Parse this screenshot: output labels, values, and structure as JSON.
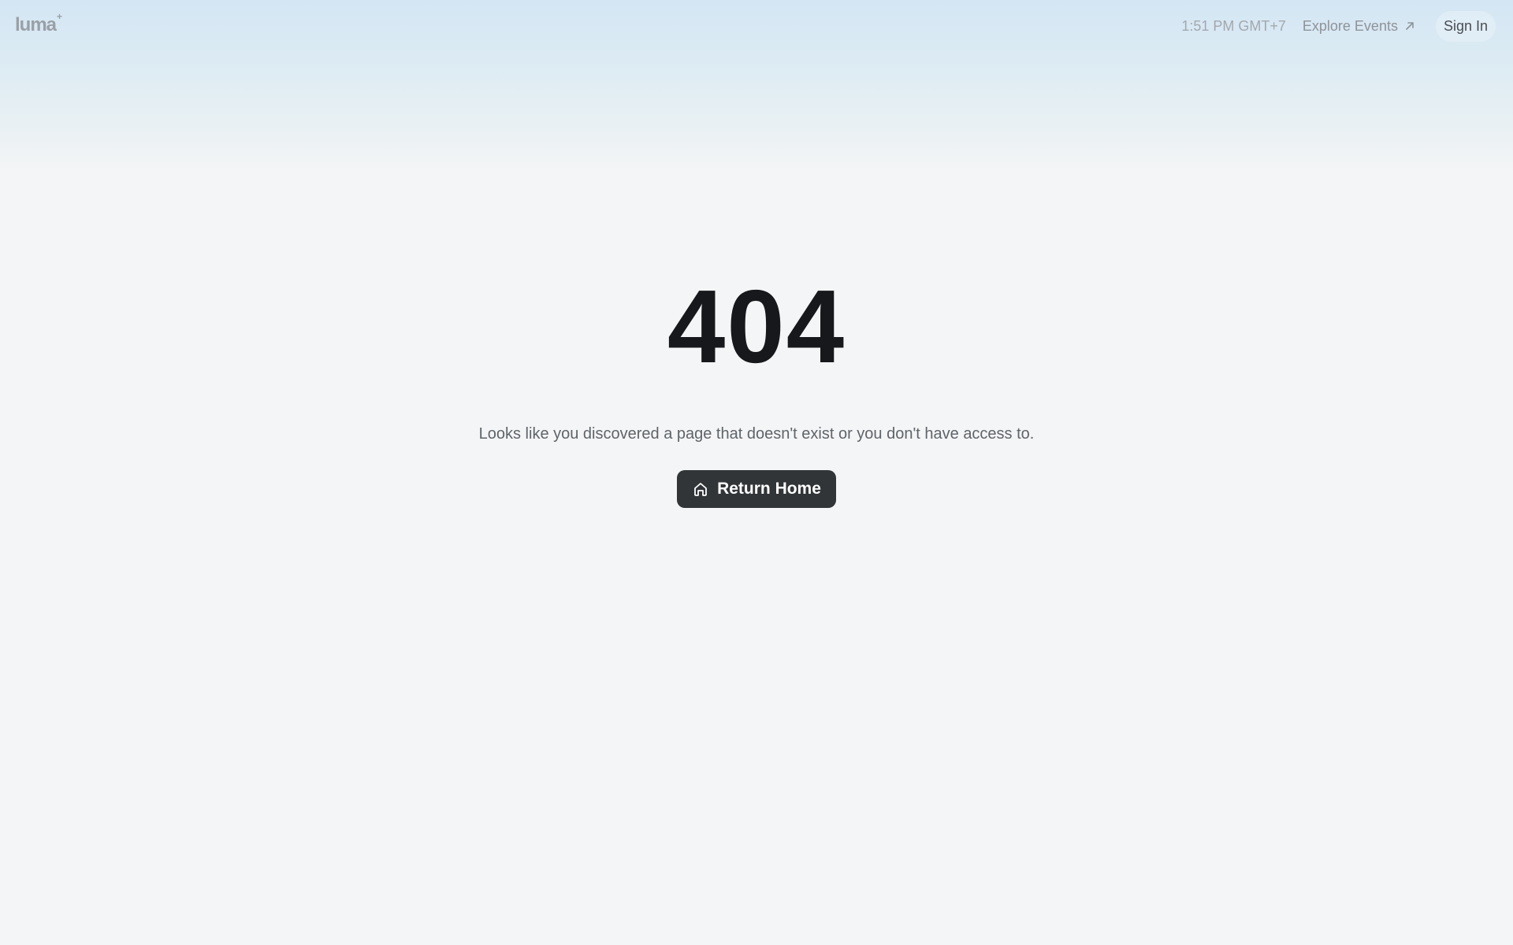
{
  "header": {
    "logo": "luma",
    "logo_mark": "+",
    "time": "1:51 PM GMT+7",
    "explore_label": "Explore Events",
    "explore_icon": "arrow-up-right-icon",
    "sign_in_label": "Sign In"
  },
  "main": {
    "code": "404",
    "message": "Looks like you discovered a page that doesn't exist or you don't have access to.",
    "button_label": "Return Home",
    "button_icon": "home-icon"
  },
  "colors": {
    "background": "#f4f5f6",
    "header_gradient_top": "#d4e6f4",
    "button_bg": "#313538",
    "heading": "#16181b"
  }
}
